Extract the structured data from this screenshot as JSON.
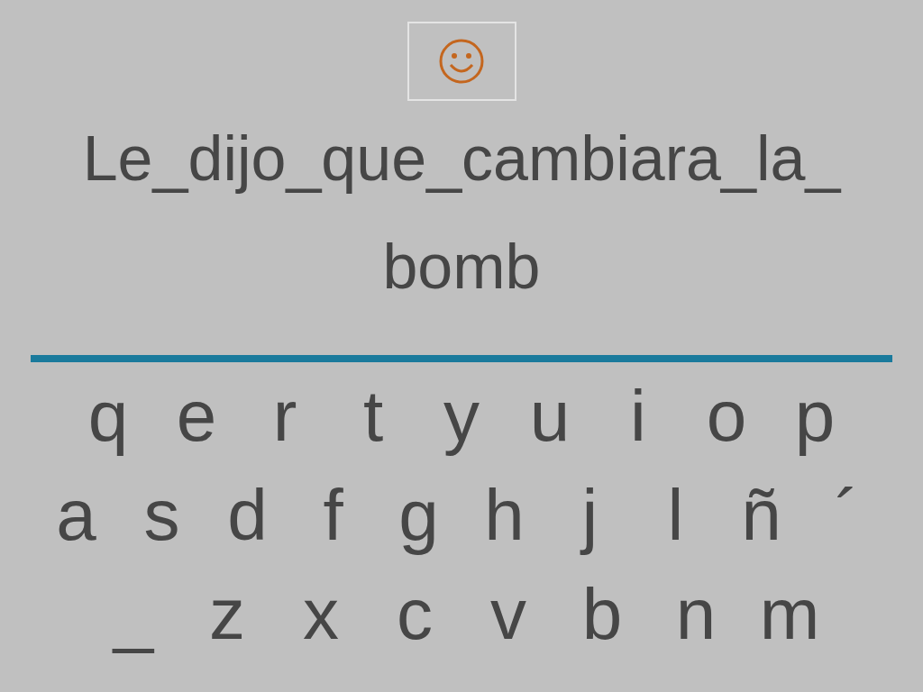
{
  "prompt_lines": [
    "Le_dijo_que_cambiara_la_",
    "bomb"
  ],
  "keyboard_rows": [
    {
      "keys": [
        "q",
        "e",
        "r",
        "t",
        "y",
        "u",
        "i",
        "o",
        "p"
      ]
    },
    {
      "keys": [
        "a",
        "s",
        "d",
        "f",
        "g",
        "h",
        "j",
        "l",
        "ñ",
        "´"
      ]
    },
    {
      "keys": [
        "_",
        "z",
        "x",
        "c",
        "v",
        "b",
        "n",
        "m"
      ]
    }
  ]
}
